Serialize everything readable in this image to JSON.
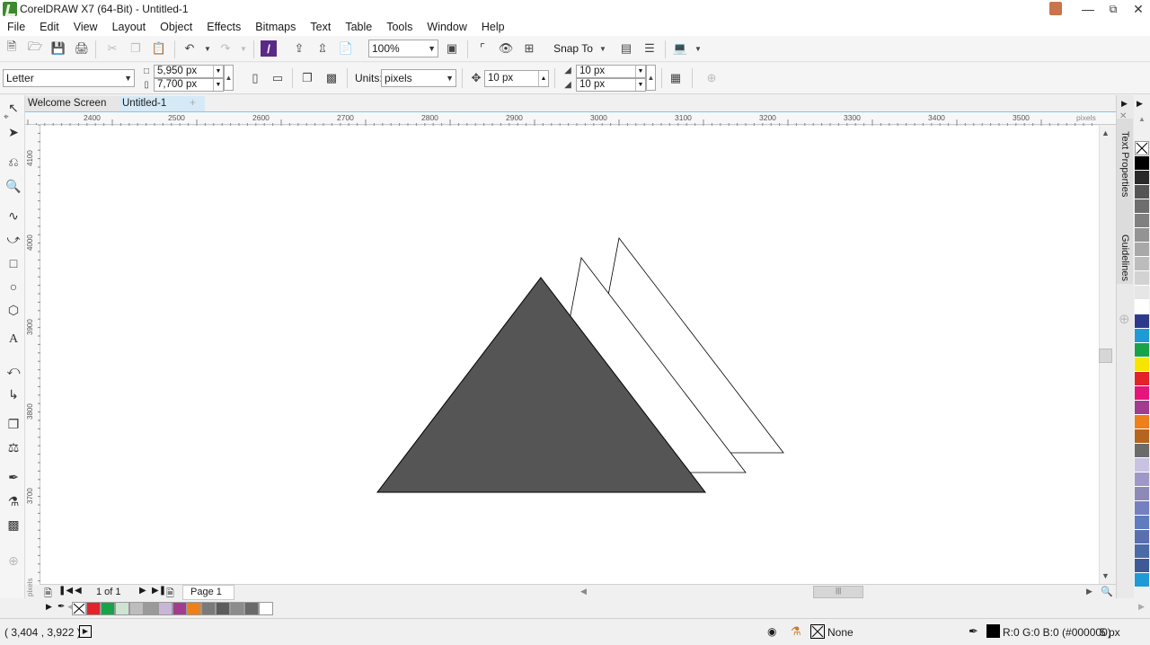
{
  "window": {
    "title": "CorelDRAW X7 (64-Bit) - Untitled-1",
    "minimize_icon": "minimize-icon",
    "restore_icon": "restore-icon",
    "close_icon": "close-icon"
  },
  "menu": [
    "File",
    "Edit",
    "View",
    "Layout",
    "Object",
    "Effects",
    "Bitmaps",
    "Text",
    "Table",
    "Tools",
    "Window",
    "Help"
  ],
  "toolbar": {
    "zoom_value": "100%",
    "snap_to_label": "Snap To"
  },
  "property_bar": {
    "page_size": "Letter",
    "width": "5,950 px",
    "height": "7,700 px",
    "units_label": "Units:",
    "units_value": "pixels",
    "nudge": "10 px",
    "dup_x": "10 px",
    "dup_y": "10 px"
  },
  "tabs": {
    "welcome": "Welcome Screen",
    "document": "Untitled-1"
  },
  "ruler": {
    "h_labels": [
      "2400",
      "2500",
      "2600",
      "2700",
      "2800",
      "2900",
      "3000",
      "3100",
      "3200",
      "3300",
      "3400",
      "3500"
    ],
    "h_unit": "pixels",
    "v_labels": [
      "4100",
      "4000",
      "3900",
      "3800",
      "3700"
    ],
    "v_unit": "pixels"
  },
  "page_nav": {
    "counter": "1 of 1",
    "page_tab": "Page 1"
  },
  "dockers": [
    "Text Properties",
    "Guidelines"
  ],
  "palette_colors": [
    "#000000",
    "#2a2a2a",
    "#555555",
    "#6e6e6e",
    "#808080",
    "#939393",
    "#a8a8a8",
    "#bcbcbc",
    "#d2d2d2",
    "#e6e6e6",
    "#ffffff",
    "#2d3a8c",
    "#1e9bd7",
    "#17a34a",
    "#f7e500",
    "#e4222a",
    "#e5157c",
    "#a23c8e",
    "#ee7f1a",
    "#b5651d",
    "#6b6b6b",
    "#c9c3e1",
    "#9e98c8",
    "#8d8ab8",
    "#7480c0",
    "#5f7cbf",
    "#5a6fae",
    "#4a6aa8",
    "#3d5a96",
    "#1e9bd7"
  ],
  "doc_palette_colors": [
    "#e4222a",
    "#17a34a",
    "#cfe4d0",
    "#bdbdbd",
    "#9a9a9a",
    "#c8b6d9",
    "#a23c8e",
    "#ee7f1a",
    "#7a7a7a",
    "#5c5c5c",
    "#8c8c8c",
    "#6a6a6a",
    "#ffffff"
  ],
  "status": {
    "coords": "( 3,404 , 3,922 )",
    "fill_label": "None",
    "outline_label": "R:0 G:0 B:0 (#000000)",
    "outline_width": "5 px"
  },
  "colors": {
    "triangle_fill": "#555555",
    "triangle_outline": "#000000",
    "back_triangle_fill": "#ffffff",
    "ui_accent": "#86c5ea",
    "app_logo": "#3c8a2e"
  }
}
